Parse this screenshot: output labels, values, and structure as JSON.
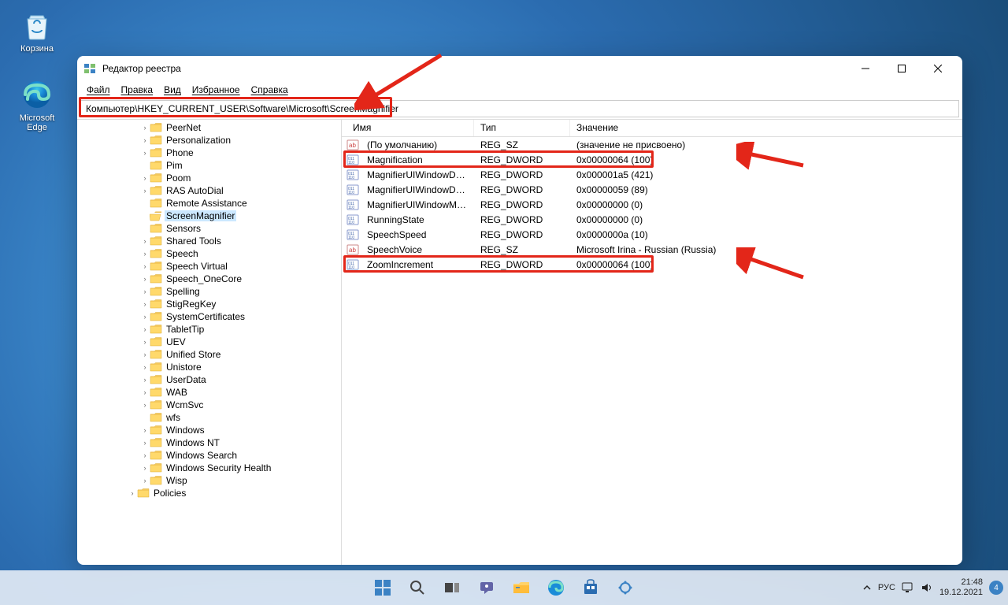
{
  "desktop": {
    "icons": [
      {
        "name": "recycle-bin-icon",
        "label": "Корзина"
      },
      {
        "name": "edge-icon",
        "label": "Microsoft Edge"
      }
    ]
  },
  "window": {
    "title": "Редактор реестра",
    "menus": [
      "Файл",
      "Правка",
      "Вид",
      "Избранное",
      "Справка"
    ],
    "address": "Компьютер\\HKEY_CURRENT_USER\\Software\\Microsoft\\ScreenMagnifier",
    "tree": [
      {
        "indent": 5,
        "label": "PeerNet",
        "exp": ">"
      },
      {
        "indent": 5,
        "label": "Personalization",
        "exp": ">"
      },
      {
        "indent": 5,
        "label": "Phone",
        "exp": ">"
      },
      {
        "indent": 5,
        "label": "Pim",
        "exp": ""
      },
      {
        "indent": 5,
        "label": "Poom",
        "exp": ">"
      },
      {
        "indent": 5,
        "label": "RAS AutoDial",
        "exp": ">"
      },
      {
        "indent": 5,
        "label": "Remote Assistance",
        "exp": ""
      },
      {
        "indent": 5,
        "label": "ScreenMagnifier",
        "exp": "",
        "selected": true,
        "open": true
      },
      {
        "indent": 5,
        "label": "Sensors",
        "exp": ""
      },
      {
        "indent": 5,
        "label": "Shared Tools",
        "exp": ">"
      },
      {
        "indent": 5,
        "label": "Speech",
        "exp": ">"
      },
      {
        "indent": 5,
        "label": "Speech Virtual",
        "exp": ">"
      },
      {
        "indent": 5,
        "label": "Speech_OneCore",
        "exp": ">"
      },
      {
        "indent": 5,
        "label": "Spelling",
        "exp": ">"
      },
      {
        "indent": 5,
        "label": "StigRegKey",
        "exp": ">"
      },
      {
        "indent": 5,
        "label": "SystemCertificates",
        "exp": ">"
      },
      {
        "indent": 5,
        "label": "TabletTip",
        "exp": ">"
      },
      {
        "indent": 5,
        "label": "UEV",
        "exp": ">"
      },
      {
        "indent": 5,
        "label": "Unified Store",
        "exp": ">"
      },
      {
        "indent": 5,
        "label": "Unistore",
        "exp": ">"
      },
      {
        "indent": 5,
        "label": "UserData",
        "exp": ">"
      },
      {
        "indent": 5,
        "label": "WAB",
        "exp": ">"
      },
      {
        "indent": 5,
        "label": "WcmSvc",
        "exp": ">"
      },
      {
        "indent": 5,
        "label": "wfs",
        "exp": ""
      },
      {
        "indent": 5,
        "label": "Windows",
        "exp": ">"
      },
      {
        "indent": 5,
        "label": "Windows NT",
        "exp": ">"
      },
      {
        "indent": 5,
        "label": "Windows Search",
        "exp": ">"
      },
      {
        "indent": 5,
        "label": "Windows Security Health",
        "exp": ">"
      },
      {
        "indent": 5,
        "label": "Wisp",
        "exp": ">"
      },
      {
        "indent": 4,
        "label": "Policies",
        "exp": ">"
      }
    ],
    "columns": {
      "name": "Имя",
      "type": "Тип",
      "value": "Значение"
    },
    "values": [
      {
        "icon": "sz",
        "name": "(По умолчанию)",
        "type": "REG_SZ",
        "value": "(значение не присвоено)"
      },
      {
        "icon": "dw",
        "name": "Magnification",
        "type": "REG_DWORD",
        "value": "0x00000064 (100)",
        "hl": true
      },
      {
        "icon": "dw",
        "name": "MagnifierUIWindowDeltaX",
        "type": "REG_DWORD",
        "value": "0x000001a5 (421)"
      },
      {
        "icon": "dw",
        "name": "MagnifierUIWindowDeltaY",
        "type": "REG_DWORD",
        "value": "0x00000059 (89)"
      },
      {
        "icon": "dw",
        "name": "MagnifierUIWindowMini...",
        "type": "REG_DWORD",
        "value": "0x00000000 (0)"
      },
      {
        "icon": "dw",
        "name": "RunningState",
        "type": "REG_DWORD",
        "value": "0x00000000 (0)"
      },
      {
        "icon": "dw",
        "name": "SpeechSpeed",
        "type": "REG_DWORD",
        "value": "0x0000000a (10)"
      },
      {
        "icon": "sz",
        "name": "SpeechVoice",
        "type": "REG_SZ",
        "value": "Microsoft Irina - Russian (Russia)"
      },
      {
        "icon": "dw",
        "name": "ZoomIncrement",
        "type": "REG_DWORD",
        "value": "0x00000064 (100)",
        "hl": true
      }
    ]
  },
  "systray": {
    "lang": "РУС",
    "time": "21:48",
    "date": "19.12.2021",
    "notif": "4"
  }
}
